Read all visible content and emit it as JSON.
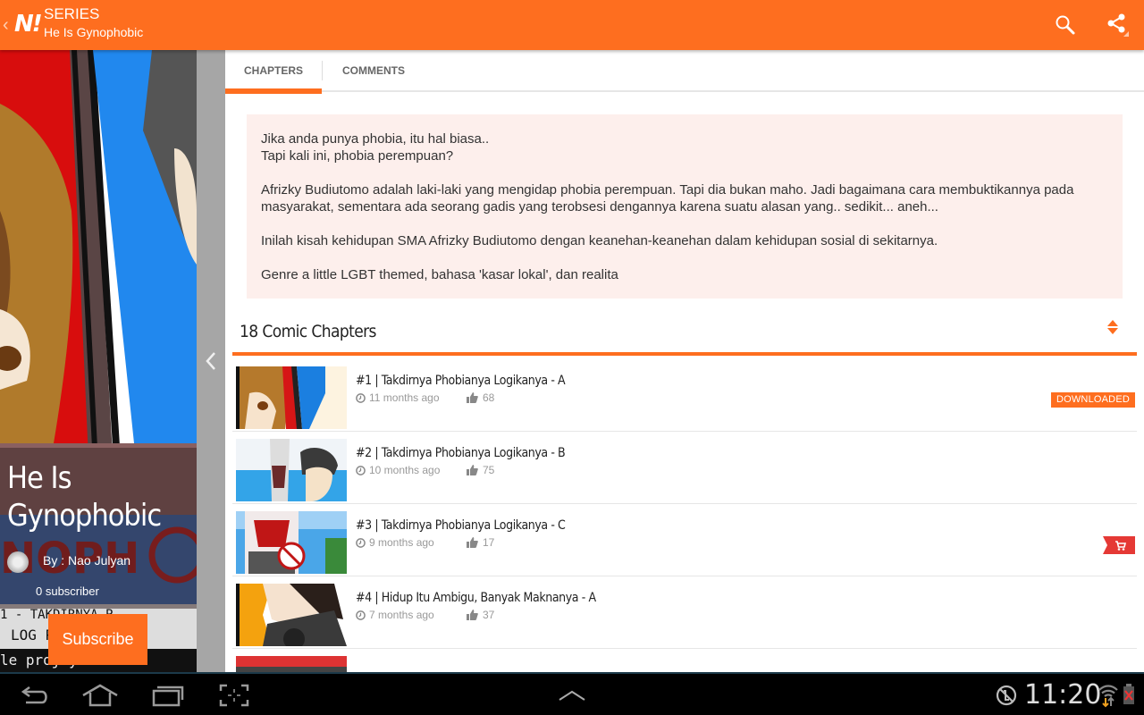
{
  "appbar": {
    "section": "SERIES",
    "series_name": "He Is Gynophobic",
    "logo_text": "N!",
    "icons": {
      "back": "chevron-left-icon",
      "search": "search-icon",
      "share": "share-icon"
    }
  },
  "series": {
    "title": "He Is Gynophobic",
    "author": "By : Nao Julyan",
    "subscribers": "0 subscriber",
    "subscribe_label": "Subscribe"
  },
  "tabs": [
    {
      "label": "CHAPTERS",
      "active": true
    },
    {
      "label": "COMMENTS",
      "active": false
    }
  ],
  "synopsis": {
    "paragraphs": [
      "Jika anda punya phobia, itu hal biasa..\nTapi kali ini, phobia perempuan?",
      "Afrizky Budiutomo adalah laki-laki yang mengidap phobia perempuan. Tapi dia bukan maho. Jadi bagaimana cara membuktikannya pada masyarakat, sementara ada seorang gadis yang terobsesi dengannya karena suatu alasan yang.. sedikit... aneh...",
      "Inilah kisah kehidupan SMA Afrizky Budiutomo dengan keanehan-keanehan dalam kehidupan sosial di sekitarnya.",
      "Genre a little LGBT themed, bahasa 'kasar lokal', dan realita"
    ]
  },
  "chapters_list": {
    "header": "18 Comic Chapters",
    "sort_icon": "sort-icon",
    "items": [
      {
        "title": "#1 | Takdirnya Phobianya Logikanya - A",
        "time": "11 months ago",
        "likes": "68",
        "status": "DOWNLOADED"
      },
      {
        "title": "#2 | Takdirnya Phobianya Logikanya - B",
        "time": "10 months ago",
        "likes": "75",
        "status": ""
      },
      {
        "title": "#3 | Takdirnya Phobianya Logikanya - C",
        "time": "9 months ago",
        "likes": "17",
        "status": "buy"
      },
      {
        "title": "#4 | Hidup Itu Ambigu, Banyak Maknanya - A",
        "time": "7 months ago",
        "likes": "37",
        "status": ""
      }
    ]
  },
  "system_bar": {
    "time": "11:20",
    "icons": [
      "back-icon",
      "home-icon",
      "recent-apps-icon",
      "screenshot-icon",
      "up-arrow-icon",
      "no-sync-icon",
      "wifi-icon",
      "battery-icon"
    ]
  },
  "colors": {
    "accent": "#fe6e1f",
    "synopsis_bg": "#fdefec",
    "buy_badge": "#e53935"
  }
}
